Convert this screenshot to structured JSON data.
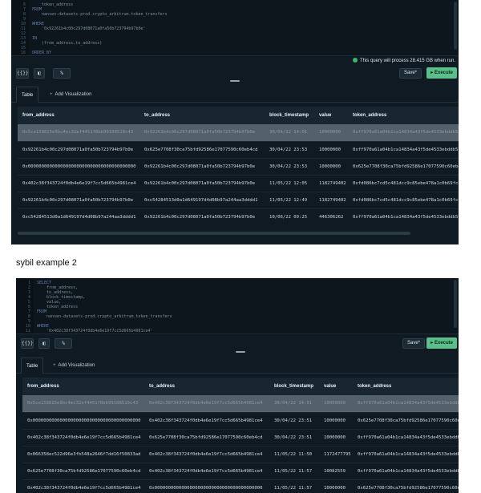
{
  "panel1": {
    "code": [
      {
        "n": "6",
        "text": "    token_address"
      },
      {
        "n": "7",
        "text": "FROM",
        "kw": true
      },
      {
        "n": "8",
        "text": "    nansen-datasets-prod.crypto_arbitrum.token_transfers"
      },
      {
        "n": "9",
        "text": ""
      },
      {
        "n": "10",
        "text": "WHERE",
        "kw": true
      },
      {
        "n": "11",
        "text": "    '0x92261b4c00c297d08071a0fa50b723794b97b0e'"
      },
      {
        "n": "12",
        "text": ""
      },
      {
        "n": "13",
        "text": "IN",
        "kw": true
      },
      {
        "n": "14",
        "text": "    (from_address,to_address)"
      },
      {
        "n": "15",
        "text": ""
      },
      {
        "n": "16",
        "text": "ORDER BY",
        "kw": true
      }
    ],
    "status": "This query will process 28.415 GB when run.",
    "toolbar": {
      "btn1": "{{}}",
      "btn2": "◧",
      "btn3": "%",
      "save": "Save*",
      "execute": "▸ Execute"
    },
    "tabs": {
      "table": "Table",
      "add_viz": "Add Visualization"
    },
    "columns": [
      "from_address",
      "to_address",
      "block_timestamp",
      "value",
      "token_address"
    ],
    "rows": [
      [
        "0x5ce158815e9bc4ec32ef4451f8bb99108519c43",
        "0x92261b4c00c297d08071a0fa50b723794b97b0e",
        "30/04/22 14:01",
        "10000000",
        "0xff970a61a04b1ca14834a43f5de4533ebddb5cc8"
      ],
      [
        "0x92261b4c00c297d08071a0fa50b723794b97b0e",
        "0x625e7708f30ca75bfd92586e17077590c60eb4cd",
        "30/04/22 23:53",
        "10000000",
        "0xff970a61a04b1ca14834a43f5de4533ebddb5cc8"
      ],
      [
        "0x0000000000000000000000000000000000000000",
        "0x92261b4c00c297d08071a0fa50b723794b97b0e",
        "30/04/22 23:53",
        "10000000",
        "0x625e7708f30ca75bfd92586e17077590c60eb4cd"
      ],
      [
        "0x402c38f343724f0db4e6e19f7cc5d665b4981ce4",
        "0x92261b4c00c297d08071a0fa50b723794b97b0e",
        "11/05/22 12:05",
        "1182749402",
        "0xfd086bc7cd5c481dcc9c85ebe478a1c0b69fcbb9"
      ],
      [
        "0x92261b4c00c297d08071a0fa50b723794b97b0e",
        "0xc54284513d0a1d649197d4d08b97a244aa3dddd1",
        "11/05/22 12:49",
        "1182749402",
        "0xfd086bc7cd5c481dcc9c85ebe478a1c0b69fcbb9"
      ],
      [
        "0xc54284513d0a1d649197d4d08b97a244aa3dddd1",
        "0x92261b4c00c297d08071a0fa50b723794b97b0e",
        "10/06/22 09:25",
        "446306262",
        "0xff970a61a04b1ca14834a43f5de4533ebddb5cc8"
      ]
    ]
  },
  "title2": "sybil example 2",
  "panel2": {
    "code": [
      {
        "n": "1",
        "text": "SELECT",
        "kw": true
      },
      {
        "n": "2",
        "text": "    from_address,"
      },
      {
        "n": "3",
        "text": "    to_address,"
      },
      {
        "n": "4",
        "text": "    block_timestamp,"
      },
      {
        "n": "5",
        "text": "    value,"
      },
      {
        "n": "6",
        "text": "    token_address"
      },
      {
        "n": "7",
        "text": "FROM",
        "kw": true
      },
      {
        "n": "8",
        "text": "    nansen-datasets-prod.crypto_arbitrum.token_transfers"
      },
      {
        "n": "9",
        "text": ""
      },
      {
        "n": "10",
        "text": "WHERE",
        "kw": true
      },
      {
        "n": "11",
        "text": "    '0x402c38f343724f0db4e6e19f7cc5d665b4981ce4'"
      }
    ],
    "toolbar": {
      "btn1": "{{}}",
      "btn2": "◧",
      "btn3": "%",
      "save": "Save*",
      "execute": "▸ Execute"
    },
    "tabs": {
      "table": "Table",
      "add_viz": "Add Visualization"
    },
    "columns": [
      "from_address",
      "to_address",
      "block_timestamp",
      "value",
      "token_address"
    ],
    "rows": [
      [
        "0x5ce158815e9bc4ec32ef4451f8bb99108519c43",
        "0x402c38f343724f0db4e6e19f7cc5d665b4981ce4",
        "30/04/22 14:01",
        "10000000",
        "0xff970a61a04b1ca14834a43f5de4533ebddb5cc8"
      ],
      [
        "0x0000000000000000000000000000000000000000",
        "0x402c38f343724f0db4e6e19f7cc5d665b4981ce4",
        "30/04/22 23:51",
        "10000000",
        "0x625e7708f30ca75bfd92586e17077590c60eb4cd"
      ],
      [
        "0x402c38f343724f0db4e6e19f7cc5d665b4981ce4",
        "0x625e7708f30ca75bfd92586e17077590c60eb4cd",
        "30/04/22 23:51",
        "10000000",
        "0xff970a61a04b1ca14834a43f5de4533ebddb5cc8"
      ],
      [
        "0x066358ec522d96e3fb548a2646f7dd16f50833ad",
        "0x402c38f343724f0db4e6e19f7cc5d665b4981ce4",
        "11/05/22 11:50",
        "1172477795",
        "0xff970a61a04b1ca14834a43f5de4533ebddb5cc8"
      ],
      [
        "0x625e7708f30ca75bfd92586e17077590c60eb4cd",
        "0x402c38f343724f0db4e6e19f7cc5d665b4981ce4",
        "11/05/22 11:57",
        "10082559",
        "0xff970a61a04b1ca14834a43f5de4533ebddb5cc8"
      ],
      [
        "0x402c38f343724f0db4e6e19f7cc5d665b4981ce4",
        "0x0000000000000000000000000000000000000000",
        "11/05/22 11:57",
        "10000000",
        "0x625e7708f30ca75bfd92586e17077590c60eb4cd"
      ]
    ]
  }
}
